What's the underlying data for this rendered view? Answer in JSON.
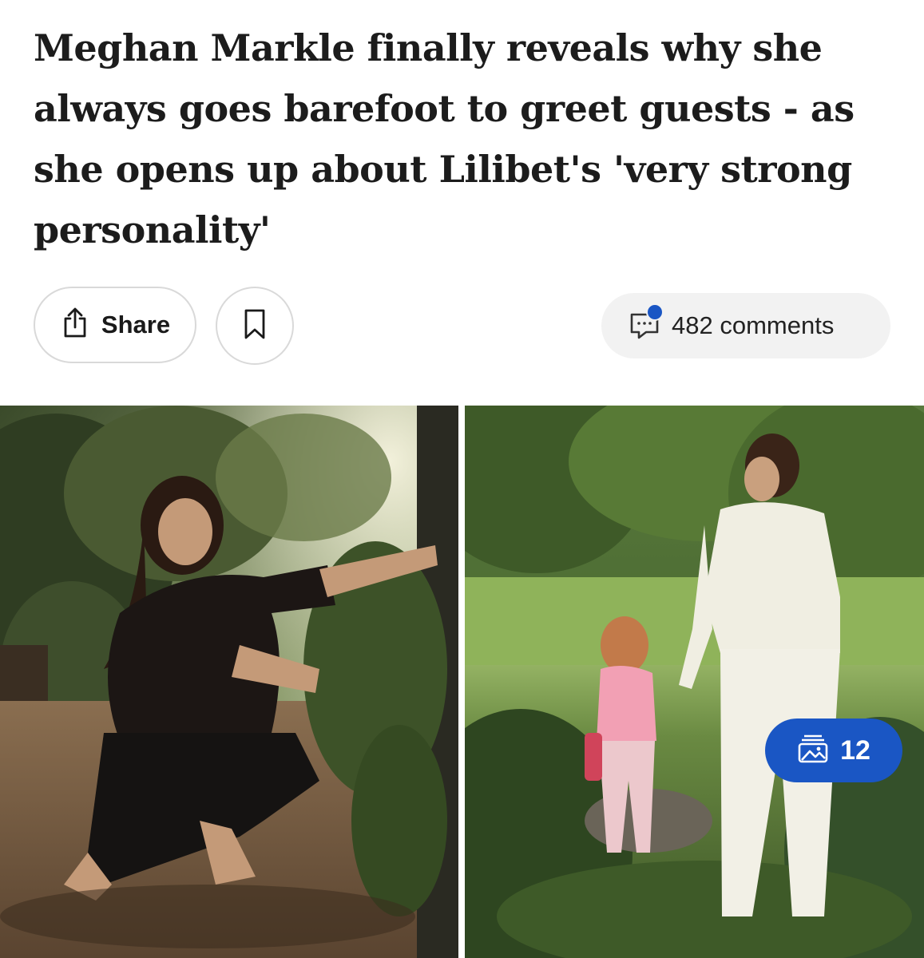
{
  "article": {
    "headline": "Meghan Markle finally reveals why she always goes barefoot to greet guests - as she opens up about Lilibet's 'very strong personality'"
  },
  "actions": {
    "share_label": "Share",
    "share_icon": "share-icon",
    "bookmark_icon": "bookmark-icon",
    "comments_label": "482 comments",
    "comments_icon": "comment-icon",
    "notification_color": "#1a56c4"
  },
  "gallery": {
    "photos": [
      {
        "alt": "woman kneeling barefoot in garden trimming plants"
      },
      {
        "alt": "woman holding hands with young girl in pink in a garden"
      }
    ],
    "image_count": "12",
    "image_count_icon": "images-icon",
    "badge_color": "#1a56c4"
  }
}
